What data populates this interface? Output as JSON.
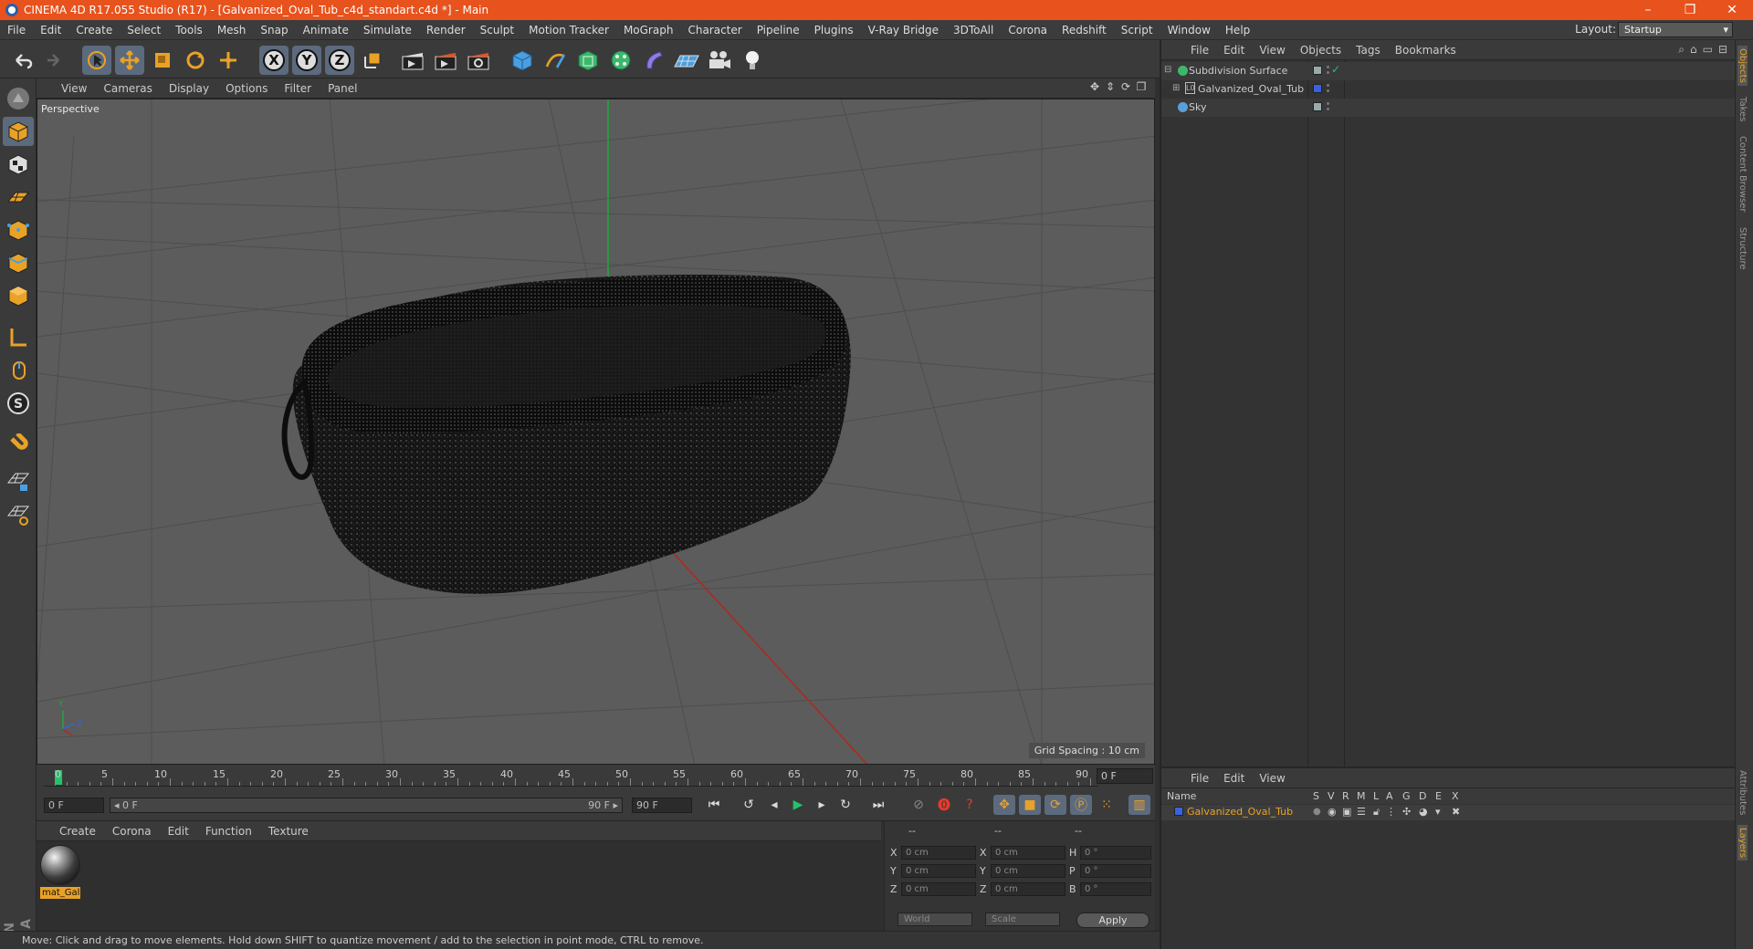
{
  "window": {
    "title": "CINEMA 4D R17.055 Studio (R17) - [Galvanized_Oval_Tub_c4d_standart.c4d *] - Main",
    "minimize": "–",
    "maximize": "❐",
    "close": "✕"
  },
  "menubar": [
    "File",
    "Edit",
    "Create",
    "Select",
    "Tools",
    "Mesh",
    "Snap",
    "Animate",
    "Simulate",
    "Render",
    "Sculpt",
    "Motion Tracker",
    "MoGraph",
    "Character",
    "Pipeline",
    "Plugins",
    "V-Ray Bridge",
    "3DToAll",
    "Corona",
    "Redshift",
    "Script",
    "Window",
    "Help"
  ],
  "layout": {
    "label": "Layout:",
    "value": "Startup"
  },
  "toolbar": {
    "axis_x": "X",
    "axis_y": "Y",
    "axis_z": "Z"
  },
  "viewport": {
    "menu": [
      "View",
      "Cameras",
      "Display",
      "Options",
      "Filter",
      "Panel"
    ],
    "label": "Perspective",
    "grid_spacing": "Grid Spacing : 10 cm",
    "axis_y": "Y",
    "axis_z": "Z"
  },
  "timeline": {
    "ticks": [
      "0",
      "5",
      "10",
      "15",
      "20",
      "25",
      "30",
      "35",
      "40",
      "45",
      "50",
      "55",
      "60",
      "65",
      "70",
      "75",
      "80",
      "85",
      "90"
    ],
    "current_frame": "0 F"
  },
  "transport": {
    "start_field": "0 F",
    "range_start": "◂ 0 F",
    "range_end": "90 F ▸",
    "end_field": "90 F"
  },
  "material_manager": {
    "menu": [
      "Create",
      "Corona",
      "Edit",
      "Function",
      "Texture"
    ],
    "materials": [
      {
        "name": "mat_Gal"
      }
    ]
  },
  "coordinates": {
    "headers": [
      "--",
      "--",
      "--"
    ],
    "rows": [
      {
        "a": "X",
        "av": "0 cm",
        "b": "X",
        "bv": "0 cm",
        "c": "H",
        "cv": "0 °"
      },
      {
        "a": "Y",
        "av": "0 cm",
        "b": "Y",
        "bv": "0 cm",
        "c": "P",
        "cv": "0 °"
      },
      {
        "a": "Z",
        "av": "0 cm",
        "b": "Z",
        "bv": "0 cm",
        "c": "B",
        "cv": "0 °"
      }
    ],
    "space": "World",
    "mode": "Scale",
    "apply": "Apply"
  },
  "status": "Move: Click and drag to move elements. Hold down SHIFT to quantize movement / add to the selection in point mode, CTRL to remove.",
  "objects_panel": {
    "menu": [
      "File",
      "Edit",
      "View",
      "Objects",
      "Tags",
      "Bookmarks"
    ],
    "objects": [
      {
        "name": "Subdivision Surface",
        "icon_color": "#3bb86b"
      },
      {
        "name": "Galvanized_Oval_Tub",
        "icon_color": "#bbbbbb",
        "tag_color": "#3a62e0"
      },
      {
        "name": "Sky",
        "icon_color": "#5aa0d8"
      }
    ]
  },
  "layers_panel": {
    "menu": [
      "File",
      "Edit",
      "View"
    ],
    "columns": [
      "Name",
      "S",
      "V",
      "R",
      "M",
      "L",
      "A",
      "G",
      "D",
      "E",
      "X"
    ],
    "layers": [
      {
        "name": "Galvanized_Oval_Tub",
        "color": "#3a62e0"
      }
    ]
  },
  "side_tabs": [
    "Objects",
    "Takes",
    "Content Browser",
    "Structure",
    "Attributes",
    "Layers"
  ],
  "brand": {
    "line1": "MAXON",
    "line2": "CINEMA 4D"
  }
}
